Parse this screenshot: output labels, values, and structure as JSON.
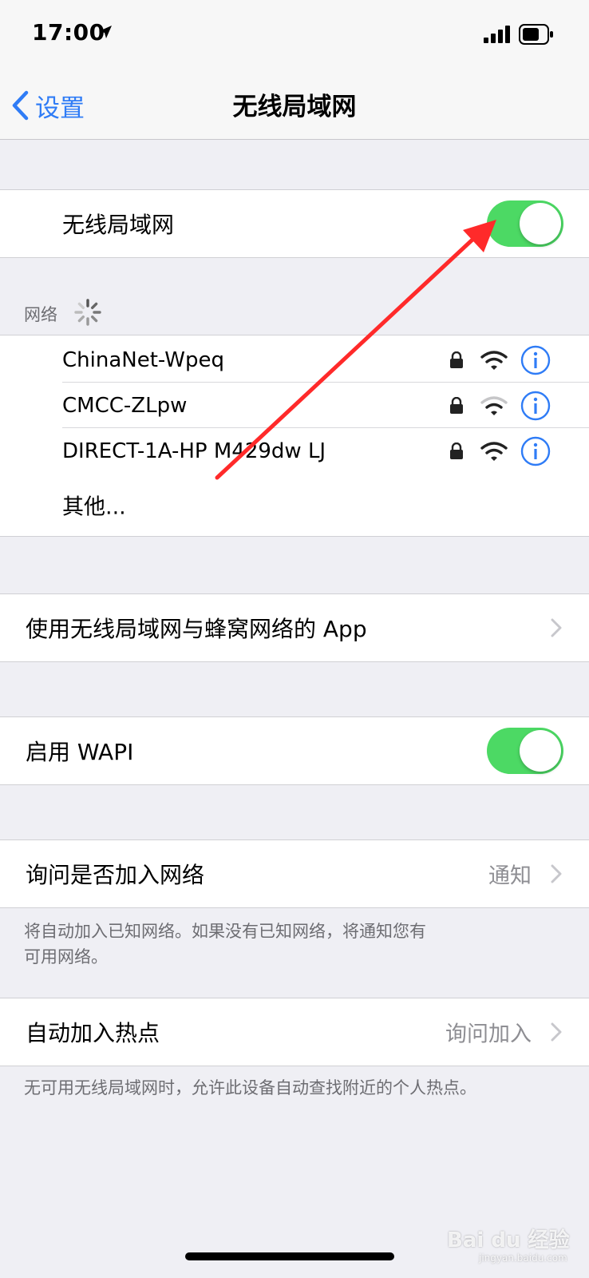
{
  "status_bar": {
    "time": "17:00",
    "icons": [
      "location-arrow-icon",
      "signal-bars-icon",
      "battery-icon"
    ]
  },
  "nav": {
    "back_label": "设置",
    "title": "无线局域网"
  },
  "wifi_toggle": {
    "label": "无线局域网",
    "enabled": true
  },
  "networks": {
    "header": "网络",
    "items": [
      {
        "name": "ChinaNet-Wpeq",
        "locked": true,
        "signal": "full"
      },
      {
        "name": "CMCC-ZLpw",
        "locked": true,
        "signal": "partial"
      },
      {
        "name": "DIRECT-1A-HP M429dw LJ",
        "locked": true,
        "signal": "full"
      }
    ],
    "other_label": "其他..."
  },
  "apps_row": {
    "label": "使用无线局域网与蜂窝网络的 App"
  },
  "wapi": {
    "label": "启用 WAPI",
    "enabled": true
  },
  "ask_join": {
    "label": "询问是否加入网络",
    "value": "通知",
    "footer_line1": "将自动加入已知网络。如果没有已知网络，将通知您有",
    "footer_line2": "可用网络。"
  },
  "hotspot": {
    "label": "自动加入热点",
    "value": "询问加入",
    "footer": "无可用无线局域网时，允许此设备自动查找附近的个人热点。"
  },
  "watermark": {
    "text": "Bai du 经验",
    "sub": "jingyan.baidu.com"
  },
  "colors": {
    "accent_blue": "#2f7cf6",
    "toggle_green": "#4cd964",
    "annotation_red": "#ff2a2a",
    "secondary_gray": "#8e8e93"
  }
}
